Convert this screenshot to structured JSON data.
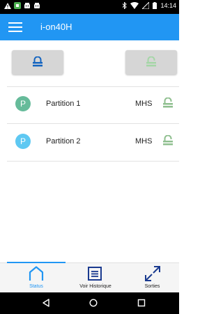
{
  "status_bar": {
    "time": "14:14",
    "left_icons": [
      "warning-icon",
      "app-icon",
      "android-icon",
      "android-icon"
    ],
    "right_icons": [
      "bluetooth-icon",
      "wifi-icon",
      "signal-icon",
      "battery-icon"
    ]
  },
  "app_bar": {
    "title": "i-on40H",
    "color": "#2196f3"
  },
  "lock_buttons": [
    {
      "icon": "lock-icon",
      "state": "active",
      "color": "#1565c0"
    },
    {
      "icon": "unlock-icon",
      "state": "inactive",
      "color": "#a5d6a7"
    }
  ],
  "partitions": [
    {
      "avatar": "P",
      "name": "Partition 1",
      "state": "MHS",
      "avatar_color": "#66bb9a"
    },
    {
      "avatar": "P",
      "name": "Partition 2",
      "state": "MHS",
      "avatar_color": "#5ec8f2"
    }
  ],
  "bottom_nav": [
    {
      "label": "Status",
      "icon": "home-outline-icon",
      "active": true
    },
    {
      "label": "Voir Historique",
      "icon": "list-icon",
      "active": false
    },
    {
      "label": "Sorties",
      "icon": "expand-arrows-icon",
      "active": false
    }
  ],
  "system_nav": [
    "back-icon",
    "home-icon",
    "recents-icon"
  ]
}
